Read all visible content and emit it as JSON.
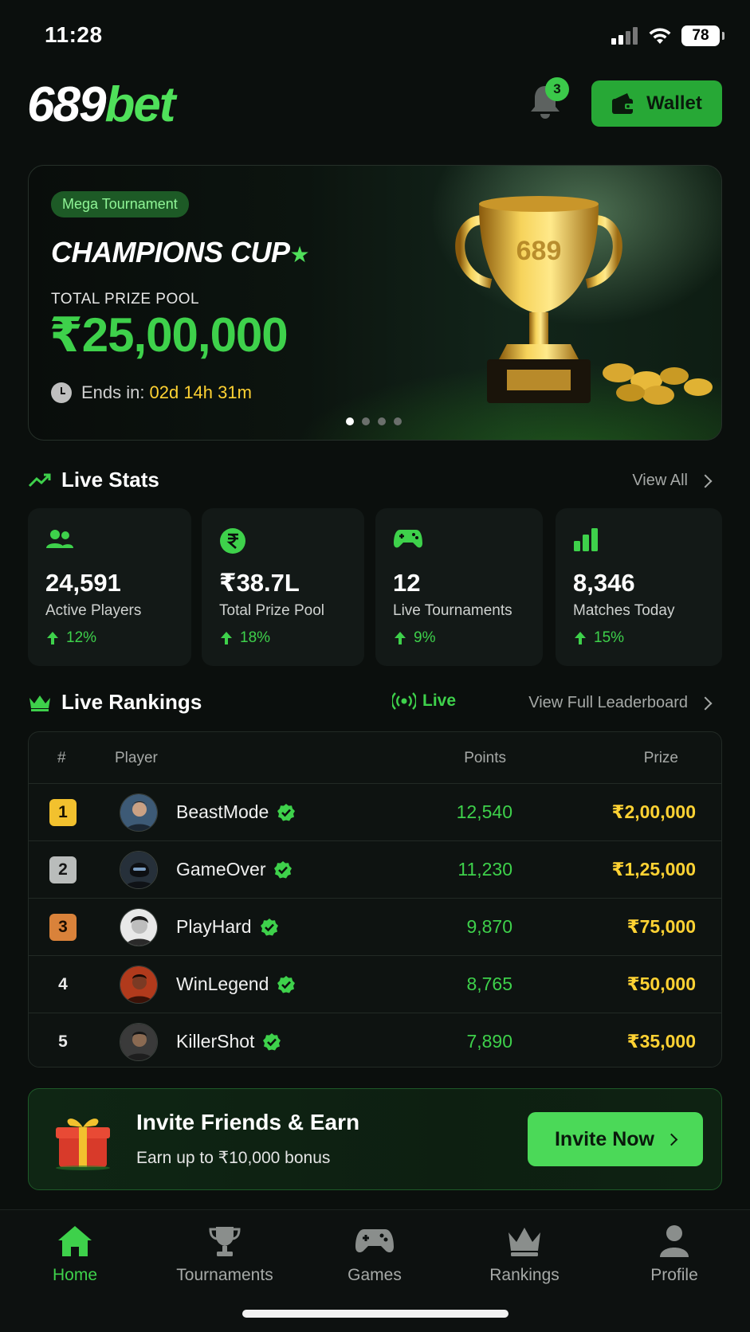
{
  "status_bar": {
    "time": "11:28",
    "battery": "78"
  },
  "header": {
    "logo_main": "689",
    "logo_accent": "bet",
    "notification_count": "3",
    "wallet_label": "Wallet"
  },
  "hero": {
    "tag": "Mega Tournament",
    "title": "CHAMPIONS CUP",
    "pool_label": "TOTAL PRIZE POOL",
    "pool_value": "₹25,00,000",
    "ends_label": "Ends in:",
    "ends_value": "02d 14h 31m",
    "slide_count": 4,
    "active_slide": 1
  },
  "live_stats": {
    "title": "Live Stats",
    "view_all": "View All",
    "cards": [
      {
        "icon": "users-icon",
        "value": "24,591",
        "label": "Active Players",
        "change": "12%"
      },
      {
        "icon": "rupee-icon",
        "value": "₹38.7L",
        "label": "Total Prize Pool",
        "change": "18%"
      },
      {
        "icon": "gamepad-icon",
        "value": "12",
        "label": "Live Tournaments",
        "change": "9%"
      },
      {
        "icon": "bar-chart-icon",
        "value": "8,346",
        "label": "Matches Today",
        "change": "15%"
      }
    ]
  },
  "rankings": {
    "title": "Live Rankings",
    "live_label": "Live",
    "view_full": "View Full Leaderboard",
    "columns": {
      "rank": "#",
      "player": "Player",
      "points": "Points",
      "prize": "Prize"
    },
    "rows": [
      {
        "rank": "1",
        "name": "BeastMode",
        "points": "12,540",
        "prize": "₹2,00,000"
      },
      {
        "rank": "2",
        "name": "GameOver",
        "points": "11,230",
        "prize": "₹1,25,000"
      },
      {
        "rank": "3",
        "name": "PlayHard",
        "points": "9,870",
        "prize": "₹75,000"
      },
      {
        "rank": "4",
        "name": "WinLegend",
        "points": "8,765",
        "prize": "₹50,000"
      },
      {
        "rank": "5",
        "name": "KillerShot",
        "points": "7,890",
        "prize": "₹35,000"
      }
    ]
  },
  "invite": {
    "title": "Invite Friends & Earn",
    "subtitle": "Earn up to ₹10,000 bonus",
    "button": "Invite Now"
  },
  "bottom_nav": {
    "items": [
      {
        "label": "Home",
        "icon": "home-icon",
        "active": true
      },
      {
        "label": "Tournaments",
        "icon": "trophy-icon",
        "active": false
      },
      {
        "label": "Games",
        "icon": "gamepad-icon",
        "active": false
      },
      {
        "label": "Rankings",
        "icon": "crown-icon",
        "active": false
      },
      {
        "label": "Profile",
        "icon": "user-icon",
        "active": false
      }
    ]
  },
  "colors": {
    "background": "#0b0f0d",
    "accent_green": "#3ed14b",
    "prize_gold": "#ffd233",
    "rank1": "#f2c12e",
    "rank2": "#b9bcbb",
    "rank3": "#d9823a"
  }
}
